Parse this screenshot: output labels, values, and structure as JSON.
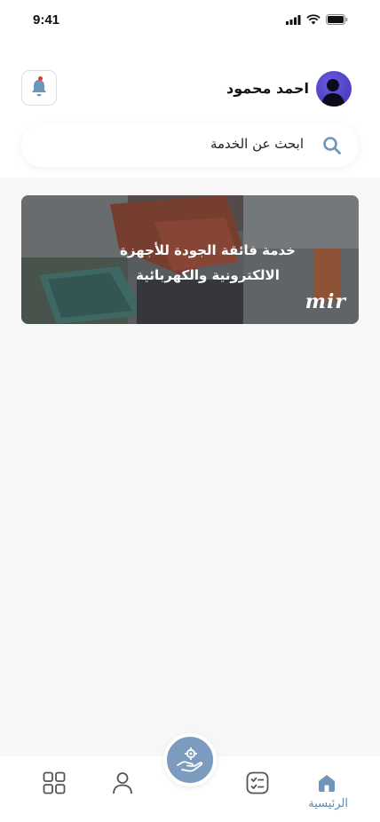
{
  "status_bar": {
    "time": "9:41"
  },
  "header": {
    "user_name": "احمد محمود"
  },
  "search": {
    "placeholder": "ابحث عن الخدمة"
  },
  "banner": {
    "title_line1": "خدمة فائقة  الجودة للأجهزة",
    "title_line2": "الالكترونية والكهربائية",
    "logo_text": "mir"
  },
  "bottom_nav": {
    "home_label": "الرئيسية",
    "items": [
      "home-icon",
      "tasks-icon",
      "profile-icon",
      "grid-icon"
    ],
    "fab_icon": "hand-gear-icon"
  },
  "colors": {
    "accent": "#5e88b0",
    "fab": "#7c9cbf",
    "notification_dot": "#e53935"
  }
}
